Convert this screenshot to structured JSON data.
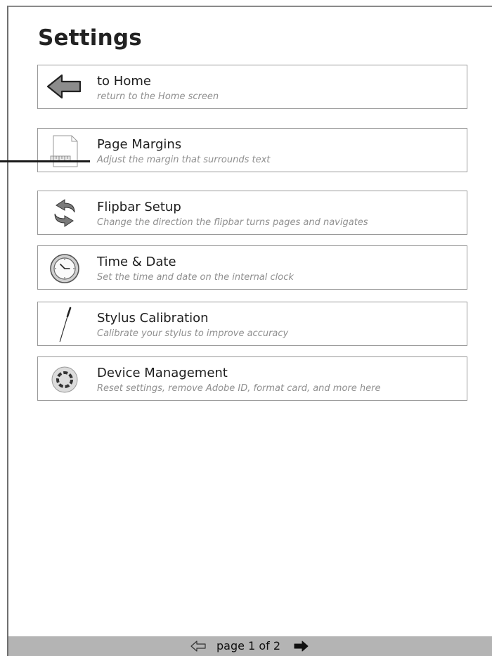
{
  "header": {
    "title": "Settings"
  },
  "menu": [
    {
      "label": "to Home",
      "description": "return to the Home screen",
      "icon": "back-arrow-icon"
    },
    {
      "label": "Page Margins",
      "description": "Adjust the margin that surrounds text",
      "icon": "page-margins-icon"
    },
    {
      "label": "Flipbar Setup",
      "description": "Change the direction the flipbar turns pages and navigates",
      "icon": "flip-arrows-icon"
    },
    {
      "label": "Time & Date",
      "description": "Set the time and date on the internal clock",
      "icon": "clock-icon"
    },
    {
      "label": "Stylus Calibration",
      "description": "Calibrate your stylus to improve accuracy",
      "icon": "stylus-icon"
    },
    {
      "label": "Device Management",
      "description": "Reset settings, remove Adobe ID, format card, and more here",
      "icon": "device-management-icon"
    }
  ],
  "footer": {
    "pager": "page 1 of 2"
  },
  "colors": {
    "footer_bg": "#b4b4b4",
    "border": "#9a9a9a",
    "desc_text": "#8f8f8f"
  }
}
